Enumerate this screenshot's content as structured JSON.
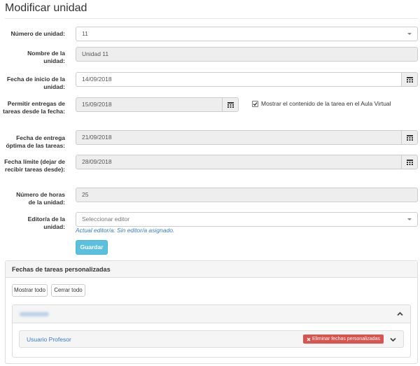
{
  "page": {
    "title": "Modificar unidad"
  },
  "form": {
    "numero_unidad": {
      "label": "Número de unidad:",
      "value": "11"
    },
    "nombre_unidad": {
      "label": "Nombre de la unidad:",
      "value": "Unidad 11"
    },
    "fecha_inicio": {
      "label": "Fecha de inicio de la unidad:",
      "value": "14/09/2018"
    },
    "permitir_entregas": {
      "label": "Permitir entregas de tareas desde la fecha:",
      "value": "15/09/2018"
    },
    "mostrar_contenido": {
      "label": "Mostrar el contenido de la tarea en el Aula Virtual",
      "checked": true
    },
    "fecha_entrega_optima": {
      "label": "Fecha de entrega óptima de las tareas:",
      "value": "21/09/2018"
    },
    "fecha_limite": {
      "label": "Fecha límite (dejar de recibir tareas desde):",
      "value": "28/09/2018"
    },
    "numero_horas": {
      "label": "Número de horas de la unidad:",
      "value": "25"
    },
    "editor": {
      "label": "Editor/a de la unidad:",
      "placeholder": "Seleccionar editor",
      "help": "Actual editor/a: Sin editor/a asignado."
    },
    "save_label": "Guardar"
  },
  "custom_dates": {
    "heading": "Fechas de tareas personalizadas",
    "show_all_label": "Mostrar todo",
    "close_all_label": "Cerrar todo",
    "user_link": "Usuario Profesor",
    "delete_label": "Eliminar fechas personalizadas"
  },
  "icons": {
    "calendar": "calendar-icon",
    "caret": "caret-down-icon",
    "chevron_up": "chevron-up-icon",
    "chevron_down": "chevron-down-icon",
    "close": "close-icon",
    "check": "checkmark-icon"
  },
  "colors": {
    "primary_button": "#5bc0de",
    "danger_button": "#d9534f",
    "link": "#3a7bc4"
  }
}
